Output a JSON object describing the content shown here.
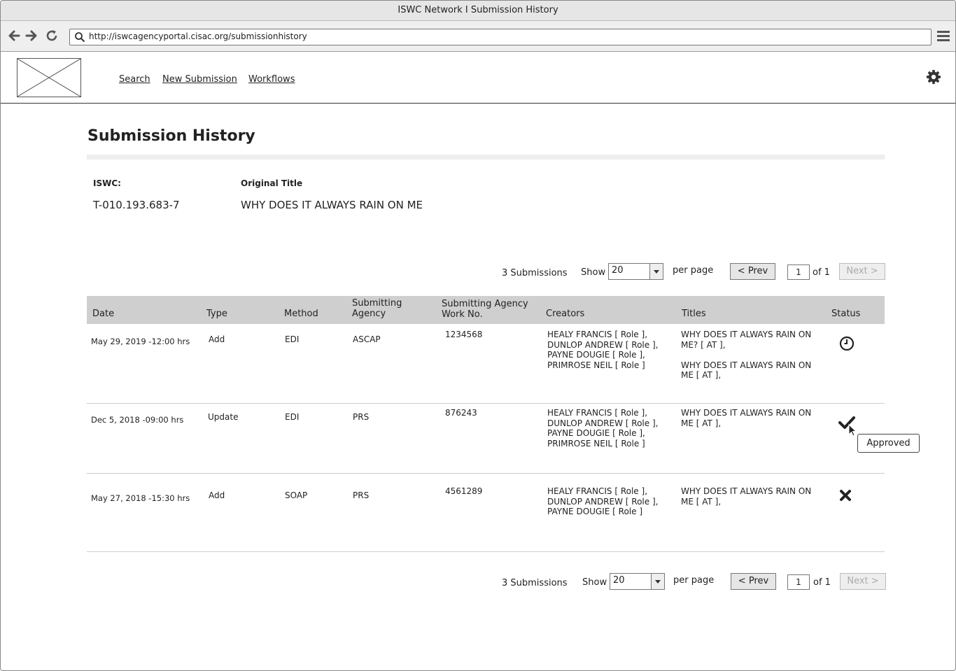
{
  "window": {
    "title": "ISWC Network I Submission History"
  },
  "browser": {
    "url": "http://iswcagencyportal.cisac.org/submissionhistory"
  },
  "nav": {
    "links": [
      "Search",
      "New Submission",
      "Workflows"
    ]
  },
  "page": {
    "title": "Submission History"
  },
  "work": {
    "iswc_label": "ISWC:",
    "iswc_value": "T-010.193.683-7",
    "title_label": "Original Title",
    "title_value": "WHY DOES IT ALWAYS RAIN ON ME"
  },
  "pager_top": {
    "count": "3 Submissions",
    "show": "Show",
    "per_page_value": "20",
    "per_page": "per page",
    "prev": "< Prev",
    "page": "1",
    "of": "of 1",
    "next": "Next >"
  },
  "pager_bottom": {
    "count": "3 Submissions",
    "show": "Show",
    "per_page_value": "20",
    "per_page": "per page",
    "prev": "< Prev",
    "page": "1",
    "of": "of 1",
    "next": "Next >"
  },
  "table": {
    "headers": {
      "date": "Date",
      "type": "Type",
      "method": "Method",
      "agency": "Submitting\nAgency",
      "workno": "Submitting Agency\nWork No.",
      "creators": "Creators",
      "titles": "Titles",
      "status": "Status"
    },
    "rows": [
      {
        "date": "May 29, 2019 -12:00 hrs",
        "type": "Add",
        "method": "EDI",
        "agency": "ASCAP",
        "workno": "1234568",
        "creators": "HEALY FRANCIS [ Role ],\nDUNLOP ANDREW [ Role ],\nPAYNE DOUGIE [ Role ],\nPRIMROSE NEIL [ Role ]",
        "titles": "WHY DOES IT ALWAYS RAIN ON\nME? [ AT ],\n\nWHY DOES IT ALWAYS RAIN ON\nME [ AT ],",
        "status_icon": "clock-icon"
      },
      {
        "date": "Dec 5, 2018 -09:00 hrs",
        "type": "Update",
        "method": "EDI",
        "agency": "PRS",
        "workno": "876243",
        "creators": "HEALY FRANCIS [ Role ],\nDUNLOP ANDREW [ Role ],\nPAYNE DOUGIE [ Role ],\nPRIMROSE NEIL [ Role ]",
        "titles": "WHY DOES IT ALWAYS RAIN ON\nME [ AT ],",
        "status_icon": "checkmark-icon"
      },
      {
        "date": "May 27, 2018 -15:30 hrs",
        "type": "Add",
        "method": "SOAP",
        "agency": "PRS",
        "workno": "4561289",
        "creators": "HEALY FRANCIS [ Role ],\nDUNLOP ANDREW [ Role ],\nPAYNE DOUGIE [ Role ]",
        "titles": "WHY DOES IT ALWAYS RAIN ON\nME [ AT ],",
        "status_icon": "cross-icon"
      }
    ]
  },
  "tooltip": {
    "text": "Approved"
  }
}
